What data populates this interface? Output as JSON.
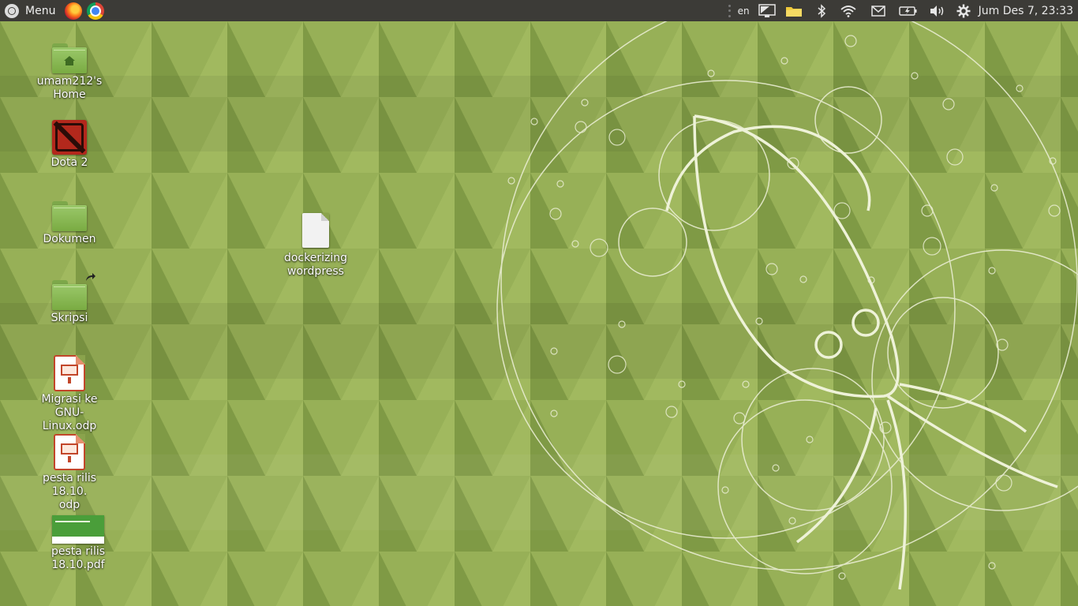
{
  "panel": {
    "menu_label": "Menu",
    "launchers": [
      {
        "name": "firefox-icon"
      },
      {
        "name": "chrome-icon"
      }
    ],
    "indicators": {
      "language": "en",
      "clock": "Jum Des  7, 23:33"
    }
  },
  "desktop": {
    "icons": [
      {
        "id": "home",
        "label": "umam212's Home",
        "icon": "home-folder-icon"
      },
      {
        "id": "dota",
        "label": "Dota 2",
        "icon": "dota2-icon"
      },
      {
        "id": "dokumen",
        "label": "Dokumen",
        "icon": "folder-icon"
      },
      {
        "id": "skripsi",
        "label": "Skripsi",
        "icon": "folder-link-icon"
      },
      {
        "id": "migrasi",
        "label": "Migrasi ke GNU-Linux.odp",
        "label_lines": [
          "Migrasi ke GNU-",
          "Linux.odp"
        ],
        "icon": "presentation-icon"
      },
      {
        "id": "pesta_odp",
        "label": "pesta rilis 18.10.odp",
        "label_lines": [
          "pesta rilis 18.10.",
          "odp"
        ],
        "icon": "presentation-icon"
      },
      {
        "id": "pesta_pdf",
        "label": "pesta rilis 18.10.pdf",
        "icon": "pdf-thumbnail-icon"
      },
      {
        "id": "docker",
        "label": "dockerizing wordpress",
        "label_lines": [
          "dockerizing",
          "wordpress"
        ],
        "icon": "text-document-icon"
      }
    ]
  },
  "colors": {
    "panel_bg": "#3c3b37",
    "wallpaper_base": "#8aa34c",
    "wallpaper_light": "#a6bd5e",
    "wallpaper_dark": "#6c8a3c",
    "line_art": "#e8ecd0"
  }
}
